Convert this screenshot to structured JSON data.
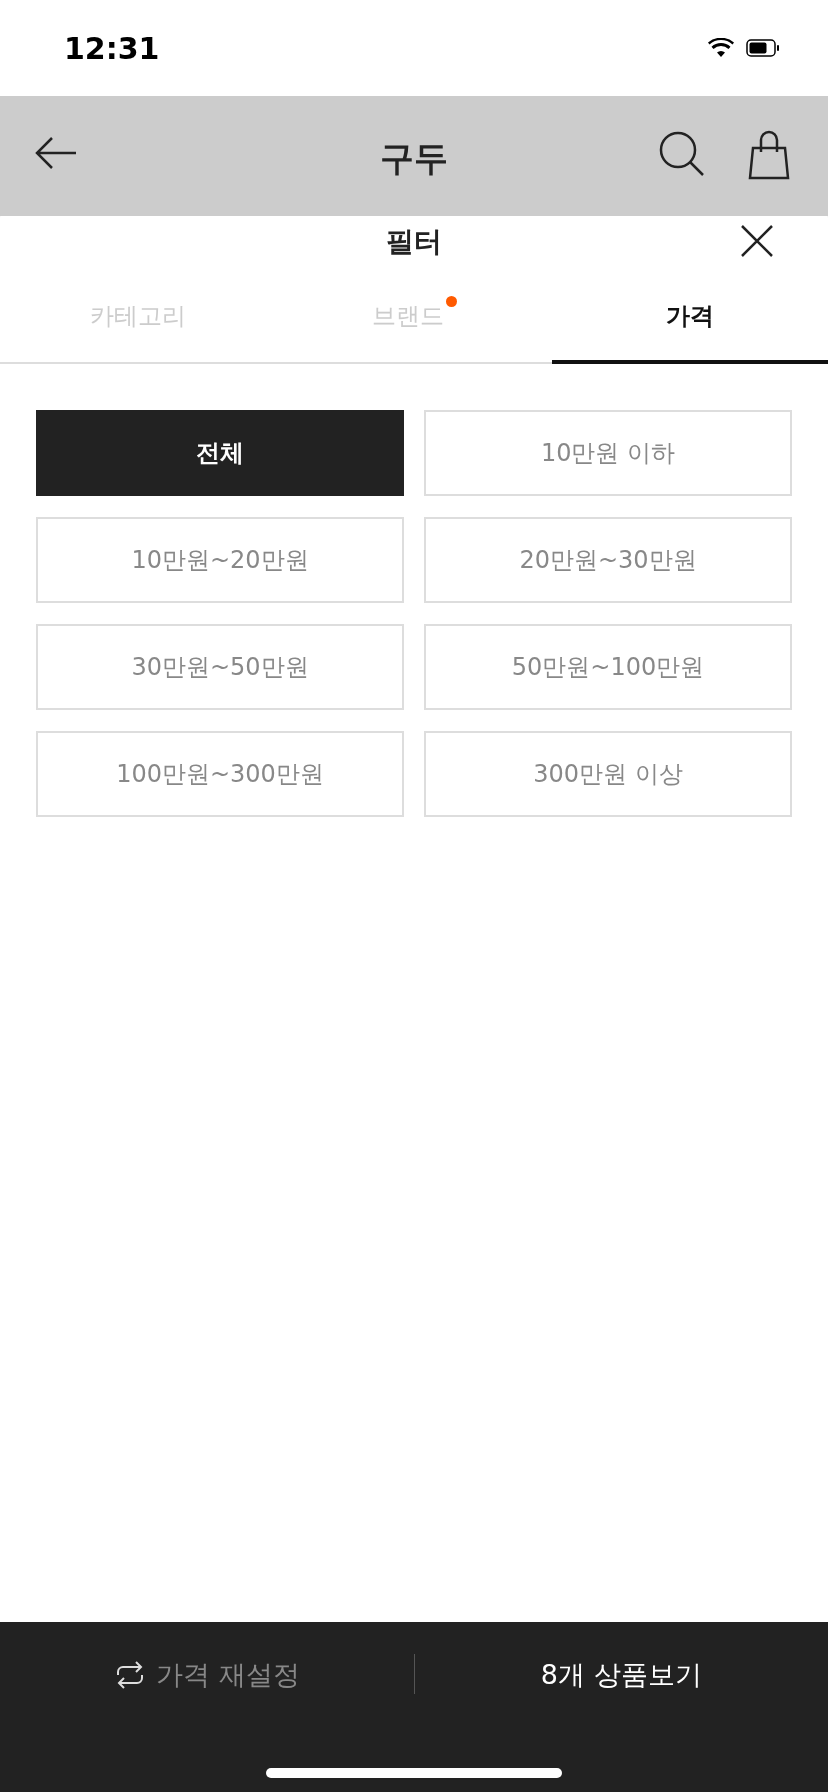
{
  "status_bar": {
    "time": "12:31"
  },
  "header": {
    "title": "구두"
  },
  "sheet": {
    "title": "필터"
  },
  "tabs": [
    {
      "label": "카테고리",
      "selected": false,
      "badge": false
    },
    {
      "label": "브랜드",
      "selected": false,
      "badge": true
    },
    {
      "label": "가격",
      "selected": true,
      "badge": false
    }
  ],
  "options": [
    {
      "label": "전체",
      "selected": true
    },
    {
      "label": "10만원 이하",
      "selected": false
    },
    {
      "label": "10만원~20만원",
      "selected": false
    },
    {
      "label": "20만원~30만원",
      "selected": false
    },
    {
      "label": "30만원~50만원",
      "selected": false
    },
    {
      "label": "50만원~100만원",
      "selected": false
    },
    {
      "label": "100만원~300만원",
      "selected": false
    },
    {
      "label": "300만원 이상",
      "selected": false
    }
  ],
  "footer": {
    "reset": "가격 재설정",
    "apply": "8개 상품보기"
  }
}
